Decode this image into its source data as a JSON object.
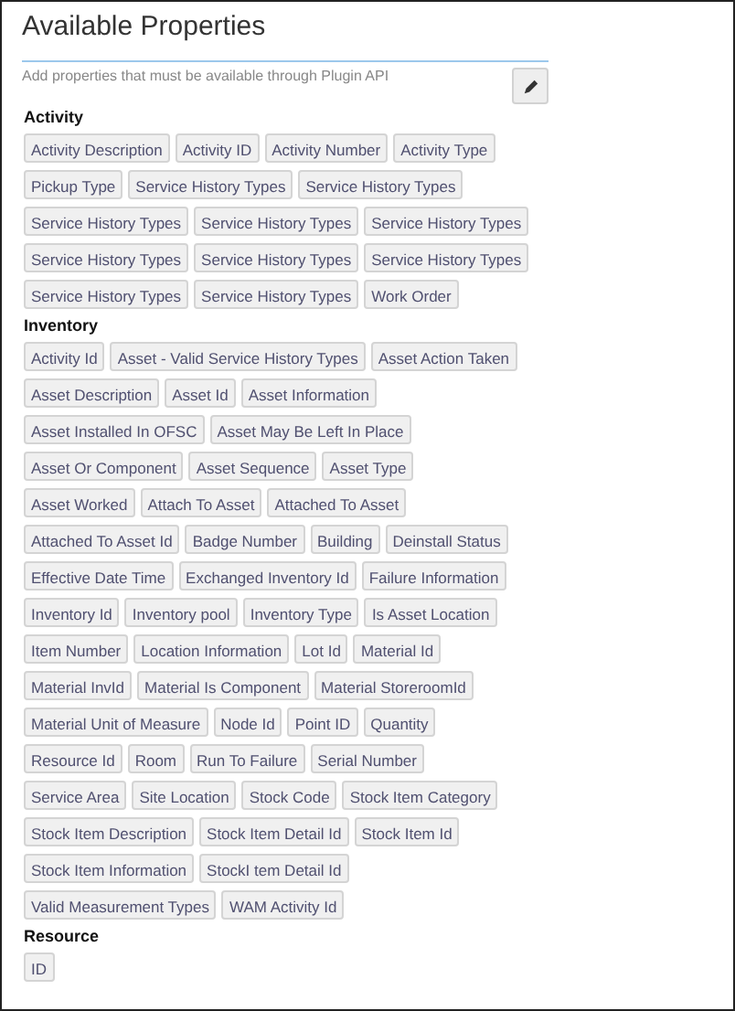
{
  "title": "Available Properties",
  "description": "Add properties that must be available through Plugin API",
  "sections": [
    {
      "heading": "Activity",
      "rows": [
        [
          "Activity Description",
          "Activity ID",
          "Activity Number",
          "Activity Type"
        ],
        [
          "Pickup Type",
          "Service History Types",
          "Service History Types"
        ],
        [
          "Service History Types",
          "Service History Types",
          "Service History Types"
        ],
        [
          "Service History Types",
          "Service History Types",
          "Service History Types"
        ],
        [
          "Service History Types",
          "Service History Types",
          "Work Order"
        ]
      ]
    },
    {
      "heading": "Inventory",
      "rows": [
        [
          "Activity Id",
          "Asset - Valid Service History Types",
          "Asset Action Taken"
        ],
        [
          "Asset Description",
          "Asset Id",
          "Asset Information"
        ],
        [
          "Asset Installed In OFSC",
          "Asset May Be Left In Place"
        ],
        [
          "Asset Or Component",
          "Asset Sequence",
          "Asset Type"
        ],
        [
          "Asset Worked",
          "Attach To Asset",
          "Attached To Asset"
        ],
        [
          "Attached To Asset Id",
          "Badge Number",
          "Building",
          "Deinstall Status"
        ],
        [
          "Effective Date Time",
          "Exchanged Inventory Id",
          "Failure Information"
        ],
        [
          "Inventory Id",
          "Inventory pool",
          "Inventory Type",
          "Is Asset Location"
        ],
        [
          "Item Number",
          "Location Information",
          "Lot Id",
          "Material Id"
        ],
        [
          "Material InvId",
          "Material Is Component",
          "Material StoreroomId"
        ],
        [
          "Material Unit of Measure",
          "Node Id",
          "Point ID",
          "Quantity"
        ],
        [
          "Resource Id",
          "Room",
          "Run To Failure",
          "Serial Number"
        ],
        [
          "Service Area",
          "Site Location",
          "Stock Code",
          "Stock Item Category"
        ],
        [
          "Stock Item Description",
          "Stock Item Detail Id",
          "Stock Item Id"
        ],
        [
          "Stock Item Information",
          "StockI tem Detail Id"
        ],
        [
          "Valid Measurement Types",
          "WAM Activity Id"
        ]
      ]
    },
    {
      "heading": "Resource",
      "rows": [
        [
          "ID"
        ]
      ]
    }
  ]
}
